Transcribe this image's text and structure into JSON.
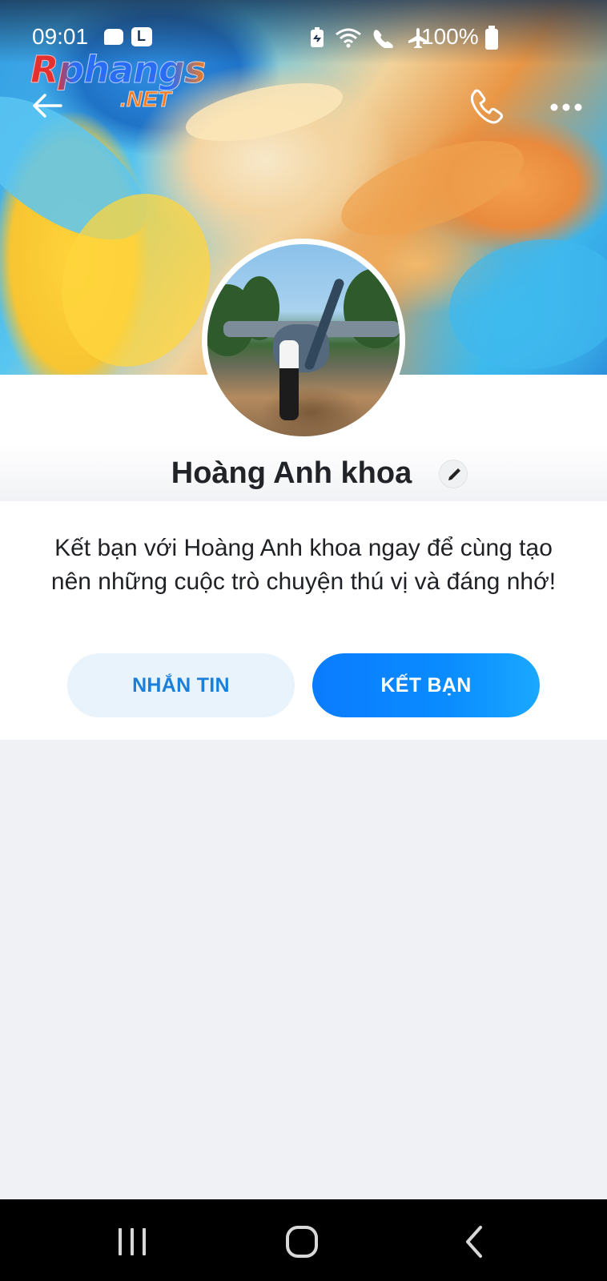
{
  "status_bar": {
    "time": "09:01",
    "battery": "100%",
    "icons": [
      "chat-bubble-icon",
      "l-app-icon",
      "battery-saver-icon",
      "wifi-icon",
      "wifi-call-icon",
      "airplane-icon",
      "battery-icon"
    ]
  },
  "watermark": {
    "main": "Rphangs",
    "sub": ".NET"
  },
  "header": {
    "back_icon": "arrow-left-icon",
    "call_icon": "phone-icon",
    "more_icon": "more-dots-icon"
  },
  "profile": {
    "name": "Hoàng Anh khoa",
    "edit_icon": "pencil-icon"
  },
  "invite": {
    "text": "Kết bạn với Hoàng Anh khoa ngay để cùng tạo nên những cuộc trò chuyện thú vị và đáng nhớ!",
    "message_button": "NHẮN TIN",
    "add_friend_button": "KẾT BẠN"
  },
  "colors": {
    "accent": "#0a7cff",
    "message_button_bg": "#e8f3fb",
    "message_button_text": "#1a7fd8",
    "page_bg": "#eff1f5"
  },
  "navigation": {
    "recent_icon": "recent-apps-icon",
    "home_icon": "home-icon",
    "back_icon": "back-chevron-icon"
  }
}
